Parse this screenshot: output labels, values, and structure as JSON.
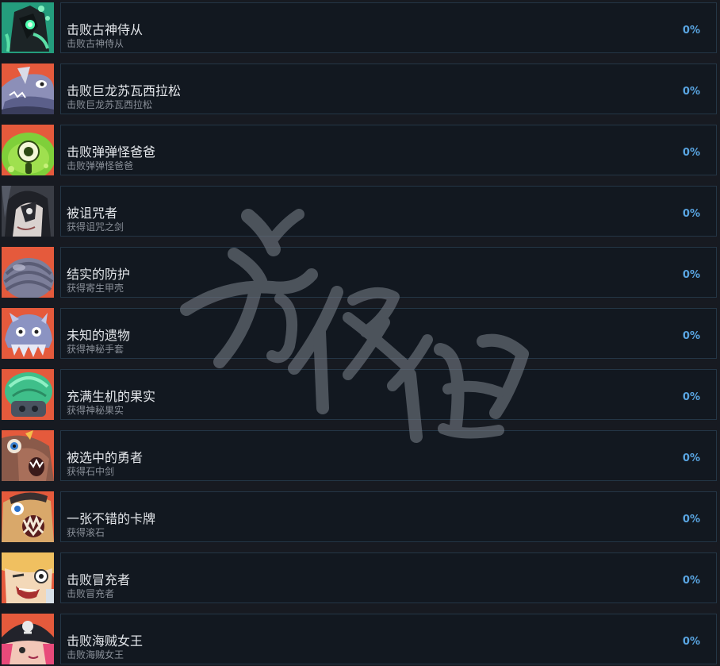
{
  "achievements": [
    {
      "title": "击败古神侍从",
      "desc": "击败古神侍从",
      "percent": "0%",
      "icon": "ancient-god-servant-icon",
      "bg": "#2bb08a"
    },
    {
      "title": "击败巨龙苏瓦西拉松",
      "desc": "击败巨龙苏瓦西拉松",
      "percent": "0%",
      "icon": "dragon-icon",
      "bg": "#e55a3c"
    },
    {
      "title": "击败弹弹怪爸爸",
      "desc": "击败弹弹怪爸爸",
      "percent": "0%",
      "icon": "bouncy-monster-icon",
      "bg": "#e55a3c"
    },
    {
      "title": "被诅咒者",
      "desc": "获得诅咒之剑",
      "percent": "0%",
      "icon": "cursed-one-icon",
      "bg": "#3a3d45"
    },
    {
      "title": "结实的防护",
      "desc": "获得寄生甲壳",
      "percent": "0%",
      "icon": "shell-armor-icon",
      "bg": "#e55a3c"
    },
    {
      "title": "未知的遗物",
      "desc": "获得神秘手套",
      "percent": "0%",
      "icon": "mystery-glove-icon",
      "bg": "#e55a3c"
    },
    {
      "title": "充满生机的果实",
      "desc": "获得神秘果实",
      "percent": "0%",
      "icon": "mystery-fruit-icon",
      "bg": "#e55a3c"
    },
    {
      "title": "被选中的勇者",
      "desc": "获得石中剑",
      "percent": "0%",
      "icon": "chosen-hero-icon",
      "bg": "#e55a3c"
    },
    {
      "title": "一张不错的卡牌",
      "desc": "获得滚石",
      "percent": "0%",
      "icon": "rolling-stone-card-icon",
      "bg": "#e55a3c"
    },
    {
      "title": "击败冒充者",
      "desc": "击败冒充者",
      "percent": "0%",
      "icon": "impostor-icon",
      "bg": "#e55a3c"
    },
    {
      "title": "击败海贼女王",
      "desc": "击败海贼女王",
      "percent": "0%",
      "icon": "pirate-queen-icon",
      "bg": "#e55a3c"
    }
  ],
  "watermark": "游侠网",
  "colors": {
    "background": "#171a21",
    "panel": "#121820",
    "border": "#243646",
    "percent": "#59a5e2"
  }
}
